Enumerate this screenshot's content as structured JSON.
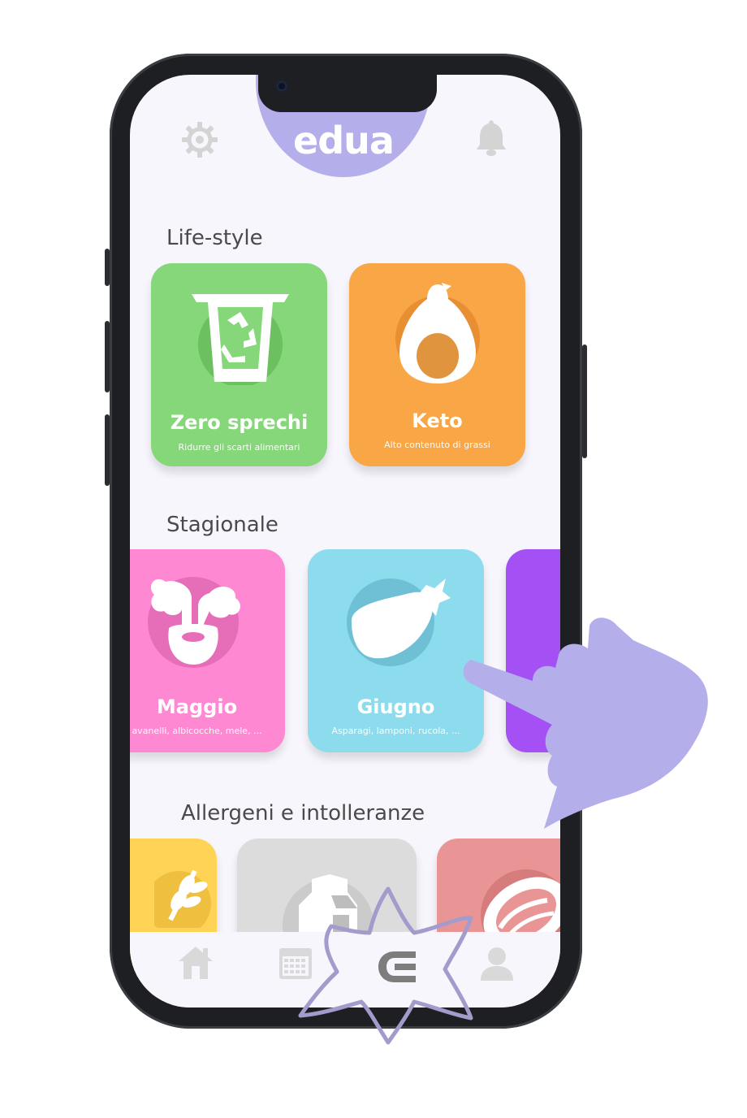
{
  "app": {
    "logo": "edua"
  },
  "header": {
    "settings_icon": "gear-icon",
    "notifications_icon": "bell-icon"
  },
  "sections": {
    "lifestyle": {
      "title": "Life-style",
      "cards": [
        {
          "title": "Zero sprechi",
          "subtitle": "Ridurre gli scarti alimentari",
          "color": "#86d67a",
          "icon": "recycle-bin-icon"
        },
        {
          "title": "Keto",
          "subtitle": "Alto contenuto di grassi",
          "color": "#f8a646",
          "icon": "avocado-icon"
        }
      ]
    },
    "seasonal": {
      "title": "Stagionale",
      "cards": [
        {
          "title": "Maggio",
          "subtitle": "avanelli, albicocche, mele, ...",
          "color": "#ff88d3",
          "icon": "radish-icon"
        },
        {
          "title": "Giugno",
          "subtitle": "Asparagi, lamponi, rucola, ...",
          "color": "#8ddcee",
          "icon": "eggplant-icon"
        },
        {
          "title": "",
          "subtitle": "",
          "color": "#a550f4",
          "icon": ""
        }
      ]
    },
    "allergens": {
      "title": "Allergeni e intolleranze",
      "cards": [
        {
          "color": "#ffd456",
          "icon": "wheat-icon"
        },
        {
          "color": "#dcdcdc",
          "icon": "milk-carton-icon"
        },
        {
          "color": "#ea9595",
          "icon": "meat-icon"
        }
      ]
    }
  },
  "tabbar": {
    "items": [
      "home-icon",
      "calendar-icon",
      "edua-tab-icon",
      "profile-icon"
    ],
    "active": "edua-tab-icon"
  },
  "colors": {
    "accent": "#b4aeea",
    "background": "#f7f6fc",
    "icon_gray": "#d9d9d9"
  }
}
